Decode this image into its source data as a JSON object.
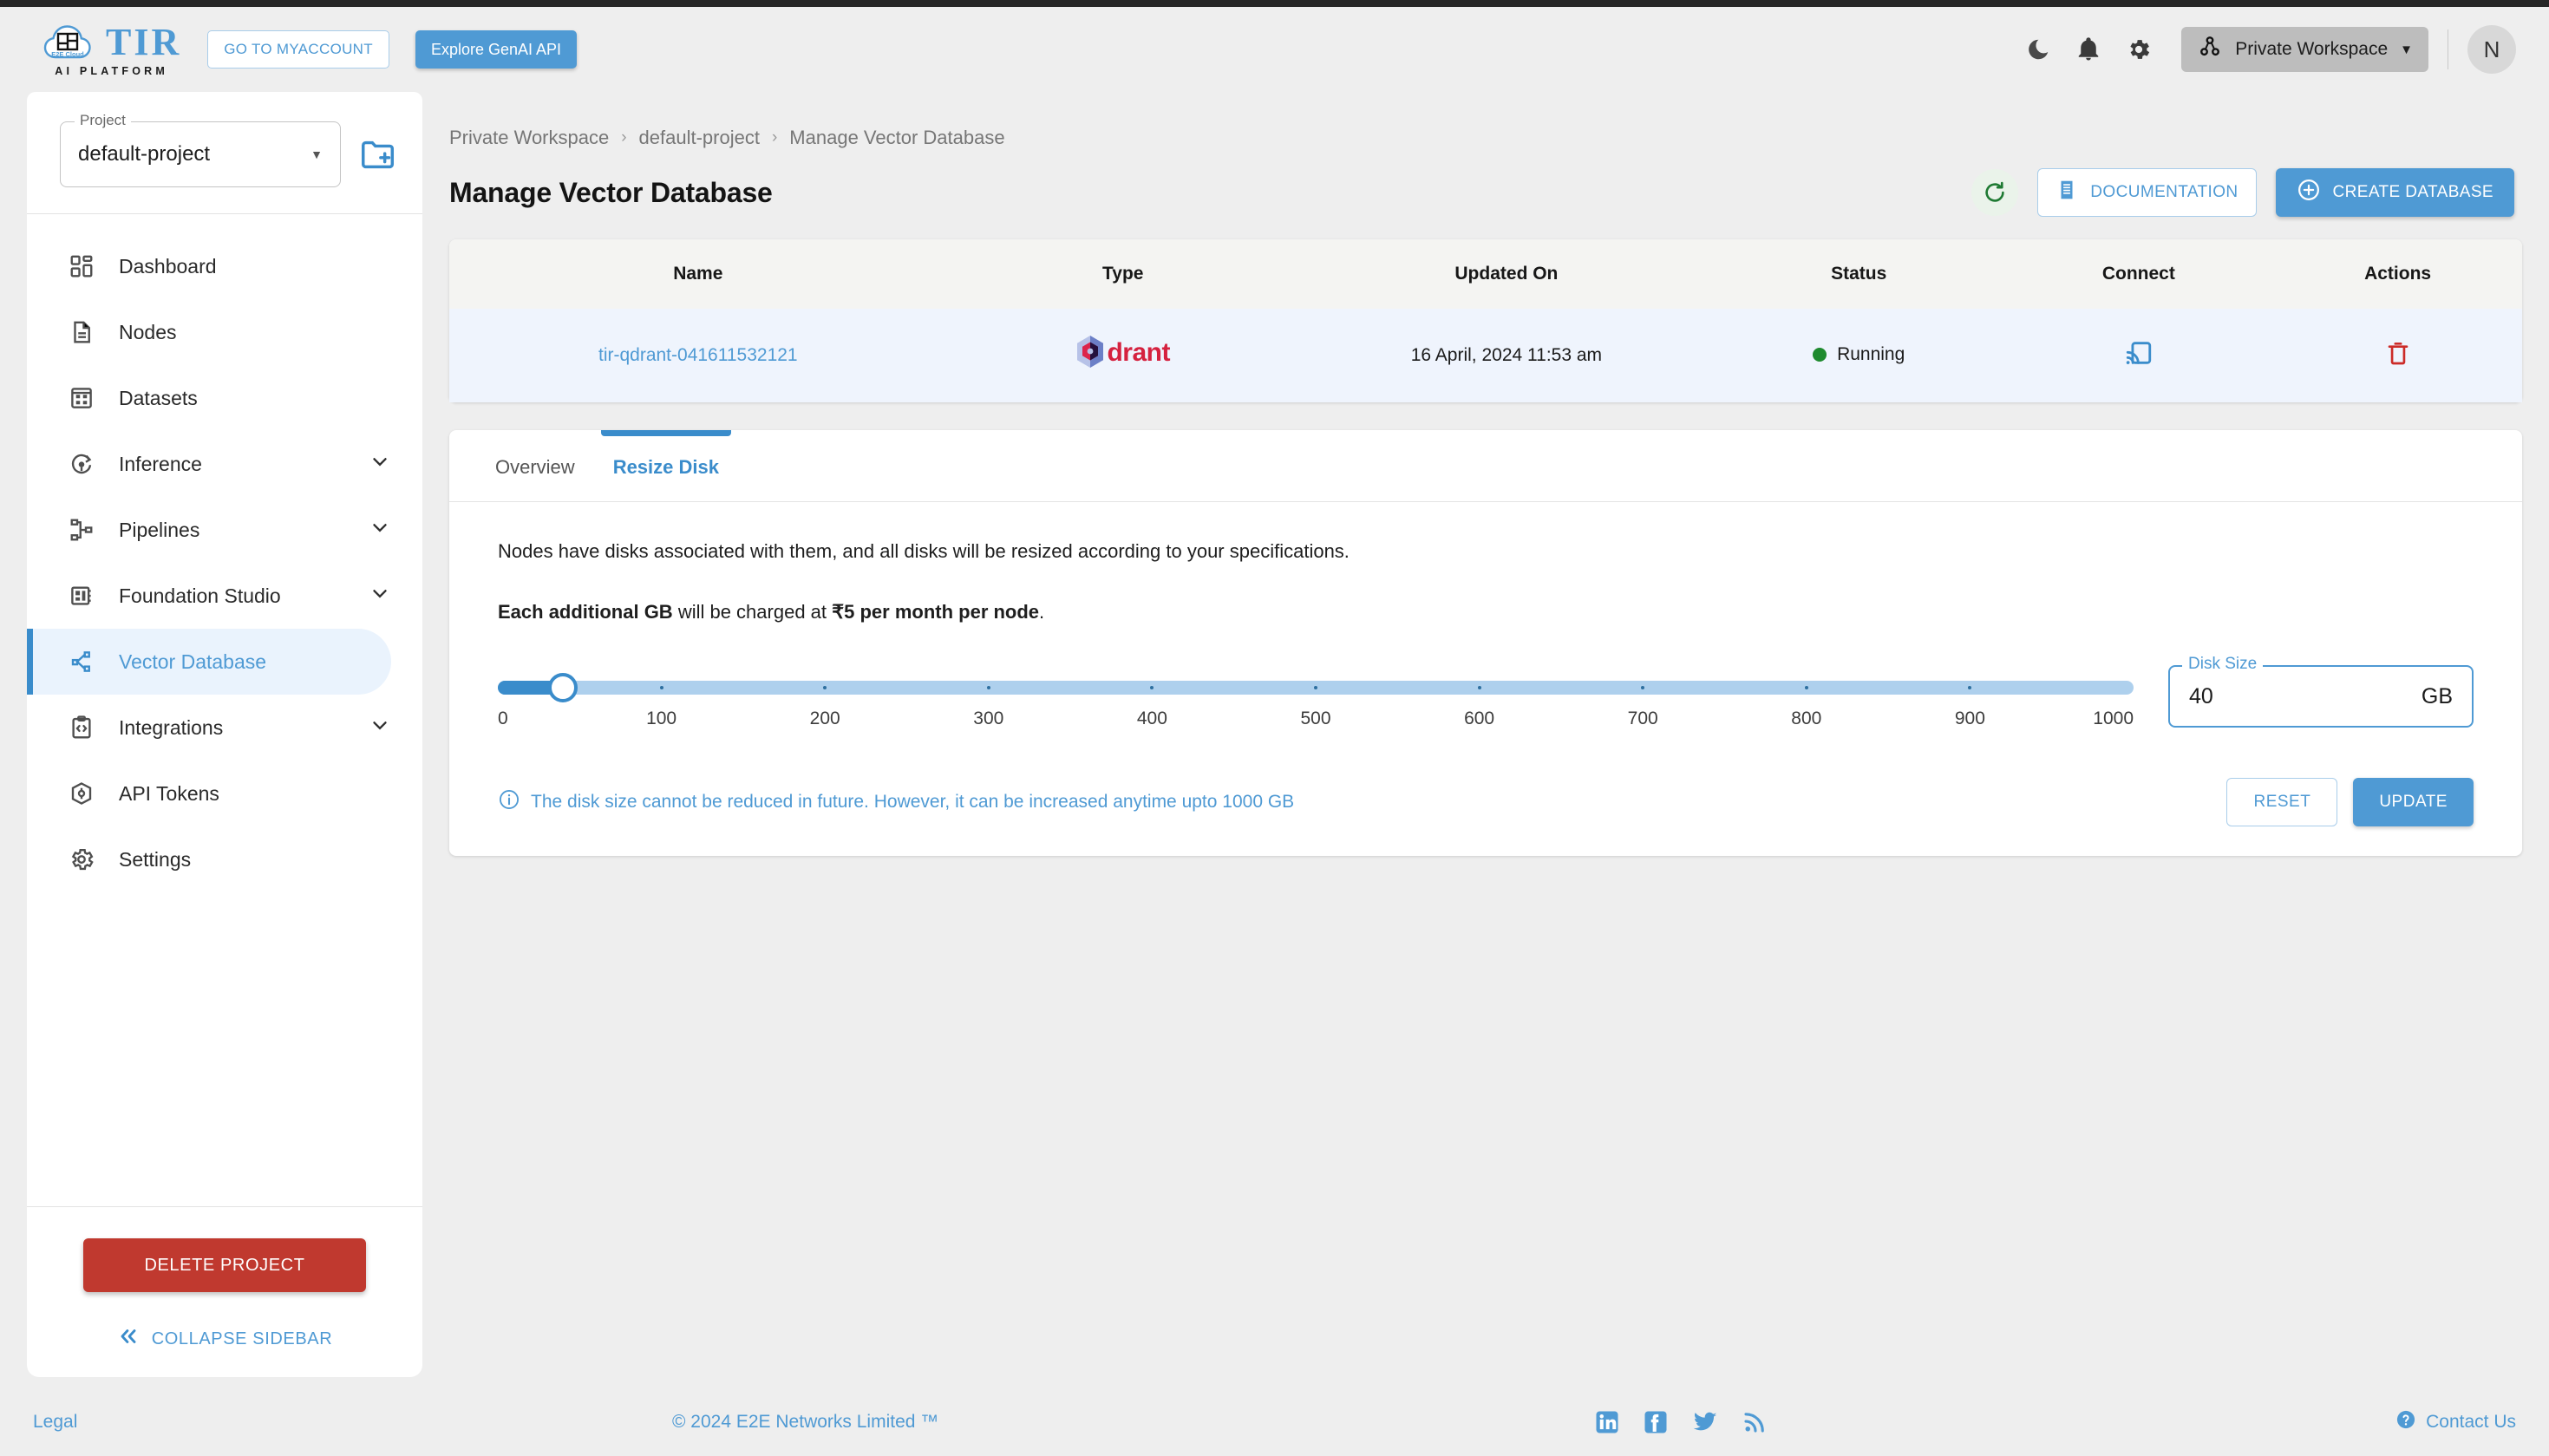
{
  "header": {
    "logo_name": "TIR",
    "logo_sub": "AI PLATFORM",
    "logo_badge": "E2E Cloud",
    "myaccount_label": "GO TO MYACCOUNT",
    "genai_label": "Explore GenAI API",
    "workspace_label": "Private Workspace",
    "avatar_initial": "N",
    "icons": [
      "dark-mode-icon",
      "notifications-icon",
      "settings-icon"
    ]
  },
  "sidebar": {
    "project_legend": "Project",
    "project_value": "default-project",
    "items": [
      {
        "label": "Dashboard",
        "icon": "dashboard-icon",
        "expandable": false,
        "active": false
      },
      {
        "label": "Nodes",
        "icon": "document-icon",
        "expandable": false,
        "active": false
      },
      {
        "label": "Datasets",
        "icon": "grid-icon",
        "expandable": false,
        "active": false
      },
      {
        "label": "Inference",
        "icon": "inference-icon",
        "expandable": true,
        "active": false
      },
      {
        "label": "Pipelines",
        "icon": "pipelines-icon",
        "expandable": true,
        "active": false
      },
      {
        "label": "Foundation Studio",
        "icon": "chip-icon",
        "expandable": true,
        "active": false
      },
      {
        "label": "Vector Database",
        "icon": "vector-db-icon",
        "expandable": false,
        "active": true
      },
      {
        "label": "Integrations",
        "icon": "code-clipboard-icon",
        "expandable": true,
        "active": false
      },
      {
        "label": "API Tokens",
        "icon": "cube-icon",
        "expandable": false,
        "active": false
      },
      {
        "label": "Settings",
        "icon": "gear-icon",
        "expandable": false,
        "active": false
      }
    ],
    "delete_project_label": "DELETE PROJECT",
    "collapse_label": "COLLAPSE SIDEBAR"
  },
  "breadcrumb": {
    "items": [
      "Private Workspace",
      "default-project",
      "Manage Vector Database"
    ],
    "separator": "›"
  },
  "page": {
    "title": "Manage Vector Database",
    "refresh_icon": "refresh-icon",
    "documentation_label": "DOCUMENTATION",
    "create_database_label": "CREATE DATABASE"
  },
  "table": {
    "columns": [
      "Name",
      "Type",
      "Updated On",
      "Status",
      "Connect",
      "Actions"
    ],
    "rows": [
      {
        "name": "tir-qdrant-041611532121",
        "type": "Qdrant",
        "type_logo_text": "drant",
        "updated_on": "16 April, 2024 11:53 am",
        "status": "Running",
        "status_color": "#1e8a2e",
        "connect_icon": "cast-connect-icon",
        "action_icon": "delete-trash-icon"
      }
    ]
  },
  "tabs": [
    {
      "label": "Overview",
      "active": false
    },
    {
      "label": "Resize Disk",
      "active": true
    }
  ],
  "resize": {
    "desc": "Nodes have disks associated with them, and all disks will be resized according to your specifications.",
    "charge_bold_prefix": "Each additional GB",
    "charge_mid": " will be charged at ",
    "charge_bold_suffix": "₹5 per month per node",
    "charge_end": ".",
    "slider": {
      "min": 0,
      "max": 1000,
      "value": 40,
      "ticks": [
        100,
        200,
        300,
        400,
        500,
        600,
        700,
        800,
        900
      ],
      "labels": [
        0,
        100,
        200,
        300,
        400,
        500,
        600,
        700,
        800,
        900,
        1000
      ],
      "fill_color": "#3a8ccb",
      "track_color": "#aed0ed"
    },
    "disk_legend": "Disk Size",
    "disk_value": "40",
    "disk_unit": "GB",
    "info_icon": "info-circle-icon",
    "info_text": "The disk size cannot be reduced in future. However, it can be increased anytime upto 1000 GB",
    "reset_label": "RESET",
    "update_label": "UPDATE"
  },
  "footer": {
    "legal": "Legal",
    "copyright": "© 2024 E2E Networks Limited ™",
    "social": [
      "linkedin-icon",
      "facebook-icon",
      "twitter-icon",
      "rss-icon"
    ],
    "contact": "Contact Us"
  }
}
